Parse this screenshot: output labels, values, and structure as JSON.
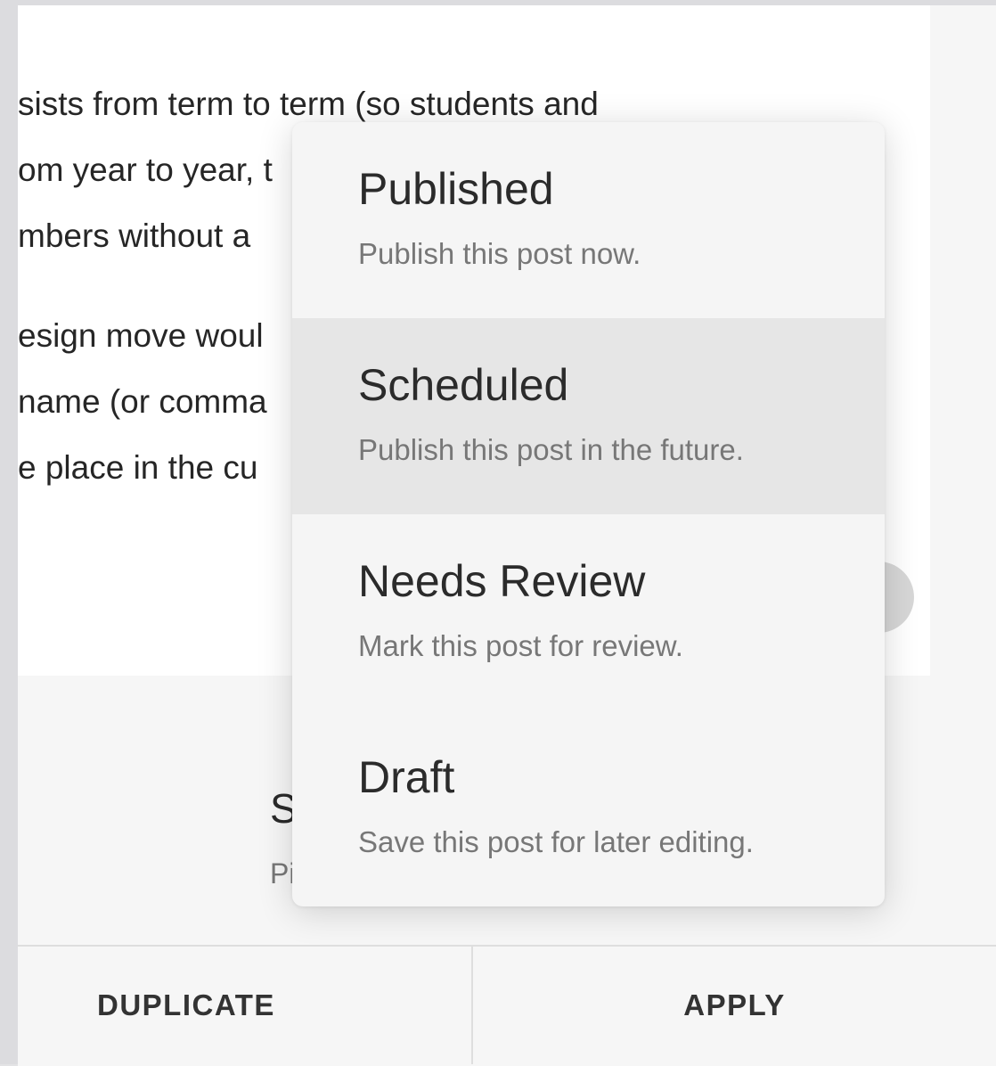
{
  "document": {
    "lines": [
      "sists from term to term (so students and",
      "om year to year, t",
      "mbers without a",
      "esign move woul",
      "name (or comma",
      "e place in the cu"
    ]
  },
  "section": {
    "title": "S",
    "subtitle": "Pi"
  },
  "status_menu": {
    "options": [
      {
        "title": "Published",
        "description": "Publish this post now."
      },
      {
        "title": "Scheduled",
        "description": "Publish this post in the future."
      },
      {
        "title": "Needs Review",
        "description": "Mark this post for review."
      },
      {
        "title": "Draft",
        "description": "Save this post for later editing."
      }
    ],
    "selected": "Scheduled"
  },
  "footer": {
    "duplicate_label": "DUPLICATE",
    "apply_label": "APPLY"
  },
  "colors": {
    "panel_bg": "#f6f6f6",
    "menu_bg": "#f5f5f5",
    "selected_bg": "#e6e6e6",
    "text_primary": "#2b2b2b",
    "text_secondary": "#777777"
  }
}
